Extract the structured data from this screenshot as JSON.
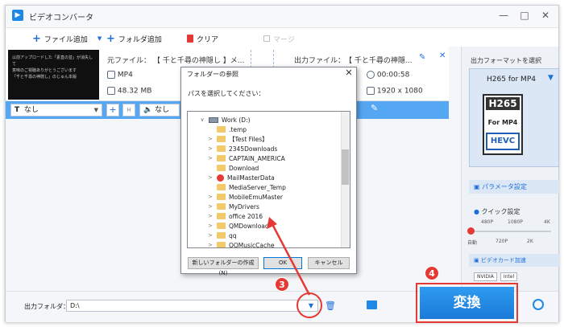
{
  "window": {
    "title": "ビデオコンバータ",
    "logo_glyph": "▶",
    "controls": [
      "—",
      "□",
      "✕"
    ]
  },
  "toolbar": {
    "add_file": "ファイル追加",
    "add_folder": "フォルダ追加",
    "clear": "クリア",
    "merge": "マージ"
  },
  "file": {
    "thumb_lines": [
      "以前アップロードした「素直の並」が消失して",
      "意味のご視聴ありがとうございます",
      "「千と千尋の神隠し」のじゅん本版"
    ],
    "source_label": "元ファイル：",
    "source_name": "【 千と千尋の神隠し 】メ...",
    "output_label": "出力ファイル：",
    "output_name": "【 千と千尋の神隠...",
    "src_format": "MP4",
    "src_size": "48.32 MB",
    "duration": "00:00:58",
    "resolution": "1920 x 1080"
  },
  "edit_bar": {
    "subtitle_value": "なし",
    "audio_value": "なし"
  },
  "format_panel": {
    "header": "出力フォーマットを選択",
    "selected": "H265 for MP4",
    "card_top": "H265",
    "card_mid": "For MP4",
    "card_bottom": "HEVC",
    "param_label": "パラメータ設定",
    "quick_label": "クイック設定",
    "quick_scale_top": [
      "480P",
      "1080P",
      "4K"
    ],
    "quick_scale_bottom": [
      "自動",
      "720P",
      "2K"
    ],
    "gpu_label": "ビデオカード加速",
    "gpu_chips": [
      "NVIDIA",
      "Intel"
    ]
  },
  "bottom": {
    "output_folder_label": "出力フォルダ：",
    "output_folder_value": "D:\\",
    "convert_label": "変換"
  },
  "dialog": {
    "title": "フォルダーの参照",
    "message": "パスを選択してください：",
    "drive": "Work (D:)",
    "folders": [
      ".temp",
      "【Test Files】",
      "2345Downloads",
      "CAPTAIN_AMERICA",
      "Download",
      "MailMasterData",
      "MediaServer_Temp",
      "MobileEmuMaster",
      "MyDrivers",
      "office 2016",
      "QMDownload",
      "qq",
      "QQMusicCache"
    ],
    "new_folder": "新しいフォルダーの作成(N)",
    "ok": "OK",
    "cancel": "キャンセル"
  },
  "badges": {
    "step3": "3",
    "step4": "4"
  },
  "colors": {
    "accent": "#1e88e5",
    "annotation": "#e53935",
    "edit_bar": "#55a7f3"
  }
}
